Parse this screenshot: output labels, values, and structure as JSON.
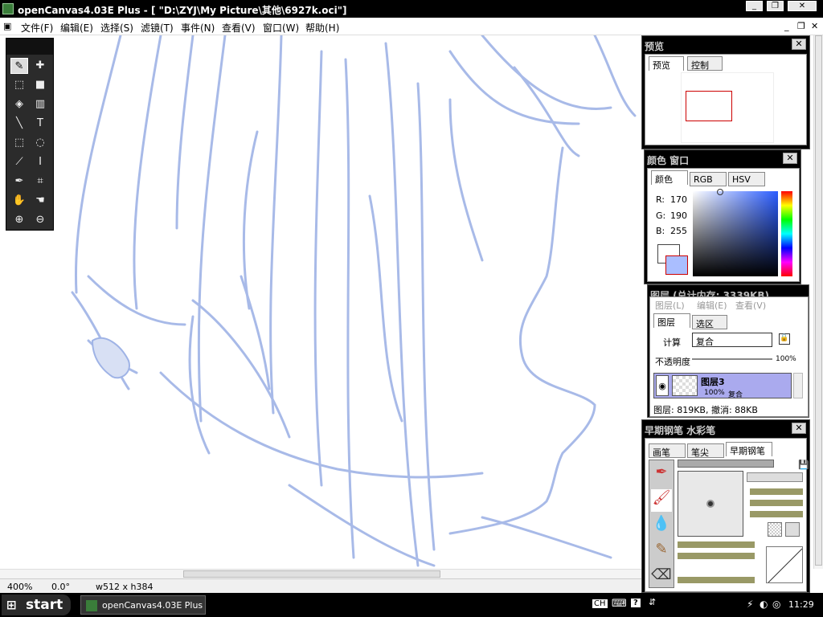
{
  "window": {
    "title": "openCanvas4.03E Plus - [ \"D:\\ZYJ\\My Picture\\其他\\6927k.oci\"]"
  },
  "menu": {
    "items": [
      "文件(F)",
      "编辑(E)",
      "选择(S)",
      "滤镜(T)",
      "事件(N)",
      "查看(V)",
      "窗口(W)",
      "帮助(H)"
    ]
  },
  "status": {
    "zoom": "400%",
    "rotation": "0.0°",
    "size": "w512 x h384"
  },
  "preview_panel": {
    "title": "预览",
    "tabs": [
      "预览",
      "控制"
    ]
  },
  "color_panel": {
    "title": "颜色 窗口",
    "tabs": [
      "颜色",
      "RGB",
      "HSV"
    ],
    "r_label": "R:",
    "r": "170",
    "g_label": "G:",
    "g": "190",
    "b_label": "B:",
    "b": "255",
    "current_color": "#aabeff"
  },
  "layer_panel": {
    "title": "图层 (总计内存: 3339KB)",
    "menu": [
      "图层(L)",
      "编辑(E)",
      "查看(V)"
    ],
    "tabs": [
      "图层",
      "选区"
    ],
    "blend_label": "计算",
    "blend_value": "复合",
    "opacity_label": "不透明度",
    "opacity_value": "100%",
    "layer_name": "图层3",
    "layer_opacity": "100%",
    "layer_mode": "复合",
    "footer": "图层: 819KB, 撤消: 88KB"
  },
  "brush_panel": {
    "title": "早期钢笔 水彩笔",
    "tabs": [
      "画笔",
      "笔尖",
      "早期钢笔"
    ]
  },
  "taskbar": {
    "start": "start",
    "task": "openCanvas4.03E Plus",
    "lang": "CH",
    "help": "?",
    "time": "11:29"
  }
}
